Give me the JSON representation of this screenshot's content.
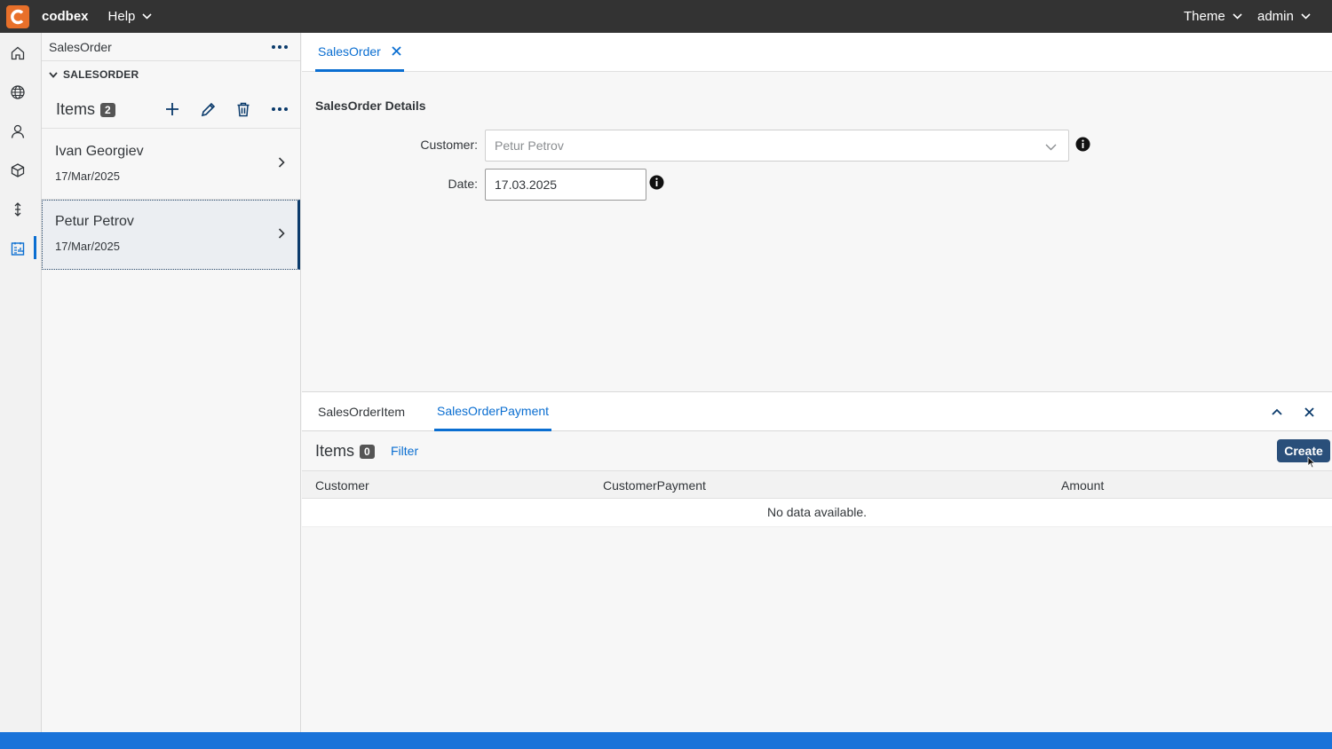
{
  "topbar": {
    "brand": "codbex",
    "help_label": "Help",
    "theme_label": "Theme",
    "user_label": "admin"
  },
  "rail": {
    "icons": [
      "home-icon",
      "globe-icon",
      "user-icon",
      "cube-icon",
      "transfer-icon",
      "report-icon"
    ],
    "active_index": 5
  },
  "explorer": {
    "title": "SalesOrder",
    "section_label": "SALESORDER",
    "items_label": "Items",
    "items_count": "2",
    "items": [
      {
        "name": "Ivan Georgiev",
        "date": "17/Mar/2025",
        "selected": false
      },
      {
        "name": "Petur Petrov",
        "date": "17/Mar/2025",
        "selected": true
      }
    ]
  },
  "main": {
    "tab_label": "SalesOrder",
    "form_title": "SalesOrder Details",
    "customer_label": "Customer:",
    "customer_value": "Petur Petrov",
    "date_label": "Date:",
    "date_value": "17.03.2025"
  },
  "detail": {
    "tabs": [
      "SalesOrderItem",
      "SalesOrderPayment"
    ],
    "active_tab": 1,
    "items_label": "Items",
    "items_count": "0",
    "filter_label": "Filter",
    "create_label": "Create",
    "columns": [
      "Customer",
      "CustomerPayment",
      "Amount"
    ],
    "empty_text": "No data available."
  },
  "colors": {
    "accent": "#0a6ed1",
    "topbar": "#333333",
    "logo": "#e8702a",
    "create_button": "#2a4f7a",
    "statusbar": "#1a73d9"
  }
}
